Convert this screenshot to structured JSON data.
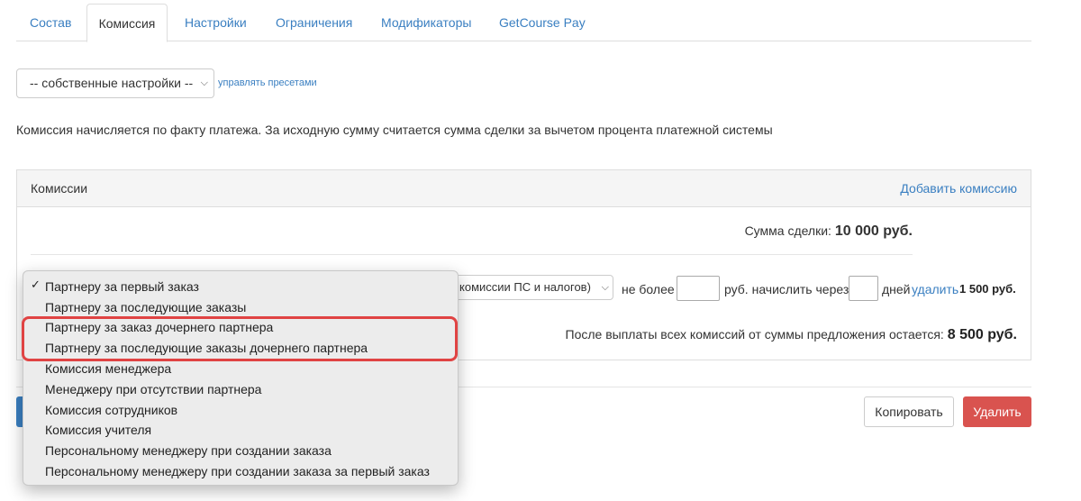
{
  "tabs": [
    "Состав",
    "Комиссия",
    "Настройки",
    "Ограничения",
    "Модификаторы",
    "GetCourse Pay"
  ],
  "preset": {
    "selected": "-- собственные настройки --",
    "manage_link": "управлять пресетами"
  },
  "info_text": "Комиссия начисляется по факту платежа. За исходную сумму считается сумма сделки за вычетом процента платежной системы",
  "panel": {
    "title": "Комиссии",
    "add_link": "Добавить комиссию",
    "deal_sum_label": "Сумма сделки:",
    "deal_sum_value": "10 000 руб.",
    "rule": {
      "base_select": "комиссии ПС и налогов)",
      "max_label": "не более",
      "max_value": "",
      "unit_label": "руб. начислить через",
      "days_value": "",
      "days_label": "дней",
      "delete_link": "удалить",
      "amount": "1 500 руб."
    },
    "remain_label": "После выплаты всех комиссий от суммы предложения остается:",
    "remain_value": "8 500 руб."
  },
  "buttons": {
    "copy": "Копировать",
    "delete": "Удалить"
  },
  "dropdown": {
    "checkmark": "✓",
    "selected_index": 0,
    "items": [
      "Партнеру за первый заказ",
      "Партнеру за последующие заказы",
      "Партнеру за заказ дочернего партнера",
      "Партнеру за последующие заказы дочернего партнера",
      "Комиссия менеджера",
      "Менеджеру при отсутствии партнера",
      "Комиссия сотрудников",
      "Комиссия учителя",
      "Персональному менеджеру при создании заказа",
      "Персональному менеджеру при создании заказа за первый заказ"
    ]
  },
  "colors": {
    "link": "#3a7fc1",
    "danger": "#d9534f",
    "highlight": "#e04343"
  }
}
